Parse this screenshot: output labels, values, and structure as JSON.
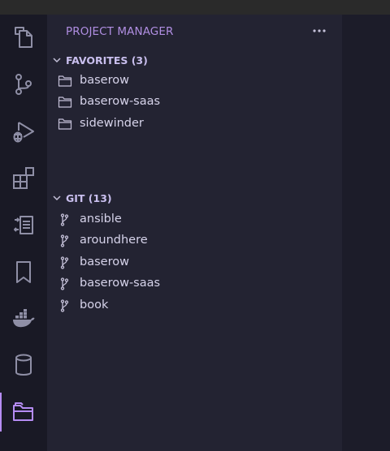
{
  "sidebar": {
    "title": "PROJECT MANAGER",
    "more_icon": "ellipsis-icon",
    "sections": [
      {
        "label": "FAVORITES (3)",
        "icon": "folder-icon",
        "items": [
          "baserow",
          "baserow-saas",
          "sidewinder"
        ]
      },
      {
        "label": "GIT (13)",
        "icon": "git-branch-icon",
        "items": [
          "ansible",
          "aroundhere",
          "baserow",
          "baserow-saas",
          "book"
        ]
      }
    ]
  },
  "activity_bar": {
    "icons": [
      "explorer-icon",
      "source-control-icon",
      "run-debug-icon",
      "extensions-icon",
      "remote-explorer-icon",
      "bookmarks-icon",
      "docker-icon",
      "database-icon",
      "project-manager-icon"
    ],
    "active": "project-manager-icon",
    "icon_color": "#8f8fa6",
    "active_color": "#b58cf3"
  },
  "colors": {
    "accent": "#b58cf3",
    "title_color": "#b08ee2"
  }
}
